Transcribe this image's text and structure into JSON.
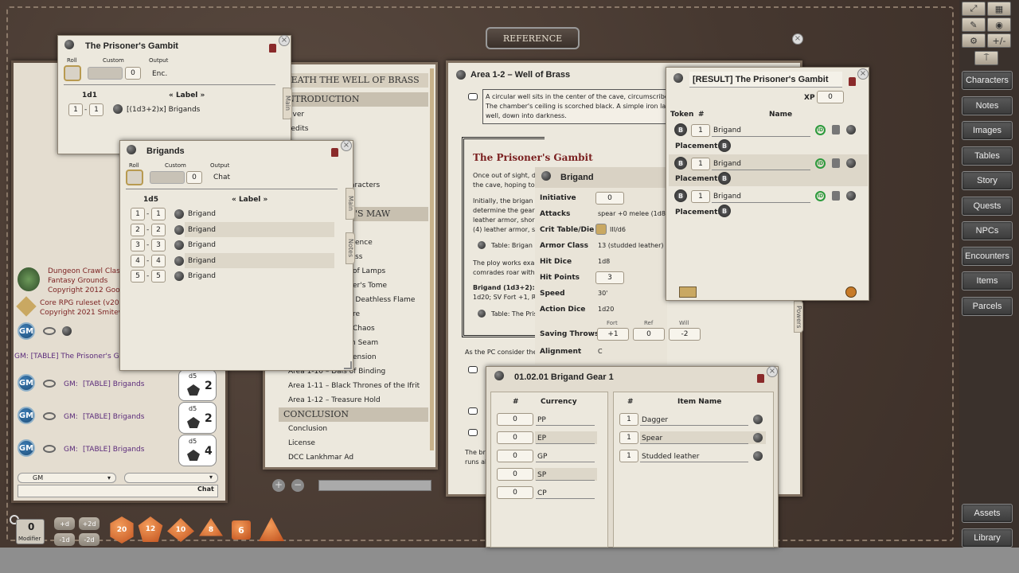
{
  "desktop": {
    "reference_label": "REFERENCE"
  },
  "sidebar": {
    "buttons": [
      "Characters",
      "Notes",
      "Images",
      "Tables",
      "Story",
      "Quests",
      "NPCs",
      "Encounters",
      "Items",
      "Parcels",
      "Assets",
      "Library"
    ]
  },
  "toolbar": {
    "plusminus": "+/-"
  },
  "prisoners_table": {
    "title": "The Prisoner's Gambit",
    "roll_label": "Roll",
    "custom_label": "Custom",
    "output_label": "Output",
    "custom_value": "0",
    "output_value": "Enc.",
    "dice": "1d1",
    "label_header": "« Label »",
    "rows": [
      {
        "from": "1",
        "to": "1",
        "text": "[(1d3+2)x] Brigands"
      }
    ],
    "tab_main": "Main"
  },
  "brigands_table": {
    "title": "Brigands",
    "roll_label": "Roll",
    "custom_label": "Custom",
    "output_label": "Output",
    "custom_value": "0",
    "output_value": "Chat",
    "dice": "1d5",
    "label_header": "« Label »",
    "rows": [
      {
        "from": "1",
        "to": "1",
        "text": "Brigand"
      },
      {
        "from": "2",
        "to": "2",
        "text": "Brigand"
      },
      {
        "from": "3",
        "to": "3",
        "text": "Brigand"
      },
      {
        "from": "4",
        "to": "4",
        "text": "Brigand"
      },
      {
        "from": "5",
        "to": "5",
        "text": "Brigand"
      }
    ],
    "tab_main": "Main",
    "tab_notes": "Notes"
  },
  "story_nav": {
    "header1": "NEATH THE WELL OF BRASS",
    "header2": "INTRODUCTION",
    "header3": "'S MAW",
    "header4": "CONCLUSION",
    "items": [
      "over",
      "redits",
      "aracters",
      "ence",
      "ss",
      "of Lamps",
      "er's Tome",
      "e Deathless Flame",
      "re",
      "Chaos",
      "n Seam",
      "ension",
      "Area 1-10 – Dais of Binding",
      "Area 1-11 – Black Thrones of the Ifrit",
      "Area 1-12 – Treasure Hold"
    ],
    "conclusion_items": [
      "Conclusion",
      "License",
      "DCC Lankhmar Ad"
    ]
  },
  "story": {
    "title": "Area 1-2 – Well of Brass",
    "intro_lines": [
      "A circular well sits in the center of the cave, circumscribed",
      "The chamber's ceiling is scorched black. A simple iron lad",
      "well, down into darkness."
    ],
    "boxed_title": "The Prisoner's Gambit",
    "p1": [
      "Once out of sight, d",
      "the cave, hoping to"
    ],
    "p2": [
      "Initially, the brigan",
      "determine the gear",
      "leather armor, shor",
      "(4) leather armor, s"
    ],
    "table_link1": "Table: Brigan",
    "p3": [
      "The ploy works exa",
      "comrades roar with"
    ],
    "brigand_stat": [
      "Brigand (1d3+2): In",
      "1d20; SV Fort +1, Re"
    ],
    "table_link2": "Table: The Pris",
    "after": "As the PC consider the",
    "bottom": [
      "The bra",
      "runs al"
    ],
    "tab_powers": "Powers"
  },
  "npc": {
    "title": "Brigand",
    "initiative_label": "Initiative",
    "initiative": "0",
    "attacks_label": "Attacks",
    "attacks": "spear +0 melee (1d8)",
    "crit_label": "Crit Table/Die",
    "crit": "III/d6",
    "ac_label": "Armor Class",
    "ac": "13 (studded leather)",
    "hd_label": "Hit Dice",
    "hd": "1d8",
    "hp_label": "Hit Points",
    "hp": "3",
    "speed_label": "Speed",
    "speed": "30'",
    "action_label": "Action Dice",
    "action": "1d20",
    "saves_label": "Saving Throws",
    "fort_label": "Fort",
    "ref_label": "Ref",
    "will_label": "Will",
    "fort": "+1",
    "ref": "0",
    "will": "-2",
    "align_label": "Alignment",
    "align": "C"
  },
  "encounter": {
    "title": "[RESULT] The Prisoner's Gambit",
    "xp_label": "XP",
    "xp": "0",
    "token_label": "Token",
    "num_label": "#",
    "name_label": "Name",
    "placement_label": "Placement:",
    "rows": [
      {
        "count": "1",
        "name": "Brigand"
      },
      {
        "count": "1",
        "name": "Brigand"
      },
      {
        "count": "1",
        "name": "Brigand"
      }
    ],
    "id_badge": "ID",
    "token_letter": "B"
  },
  "parcel": {
    "title": "01.02.01 Brigand Gear 1",
    "num_label": "#",
    "currency_label": "Currency",
    "item_name_label": "Item Name",
    "currency": [
      {
        "amount": "0",
        "code": "PP"
      },
      {
        "amount": "0",
        "code": "EP"
      },
      {
        "amount": "0",
        "code": "GP"
      },
      {
        "amount": "0",
        "code": "SP"
      },
      {
        "amount": "0",
        "code": "CP"
      }
    ],
    "items": [
      {
        "count": "1",
        "name": "Dagger"
      },
      {
        "count": "1",
        "name": "Spear"
      },
      {
        "count": "1",
        "name": "Studded leather"
      }
    ]
  },
  "chat": {
    "credits": [
      "Dungeon Crawl Classic",
      "Fantasy Grounds",
      "Copyright 2012 Goodm",
      "Core RPG ruleset (v2021-",
      "Copyright 2021 Smitewor"
    ],
    "gm_table_msg": "GM:  [TABLE] The Prisoner's Gam",
    "messages": [
      {
        "who": "GM:",
        "text": "[TABLE] Brigands",
        "die": "d5",
        "result": "2"
      },
      {
        "who": "GM:",
        "text": "[TABLE] Brigands",
        "die": "d5",
        "result": "2"
      },
      {
        "who": "GM:",
        "text": "[TABLE] Brigands",
        "die": "d5",
        "result": "4"
      }
    ],
    "gm_badge": "GM",
    "identity": "GM",
    "chat_button": "Chat"
  },
  "dicebar": {
    "modifier_value": "0",
    "modifier_label": "Modifier",
    "buttons": [
      "+d",
      "+2d",
      "-1d",
      "-2d"
    ],
    "dice": [
      "20",
      "12",
      "10",
      "8",
      "6",
      ""
    ]
  }
}
